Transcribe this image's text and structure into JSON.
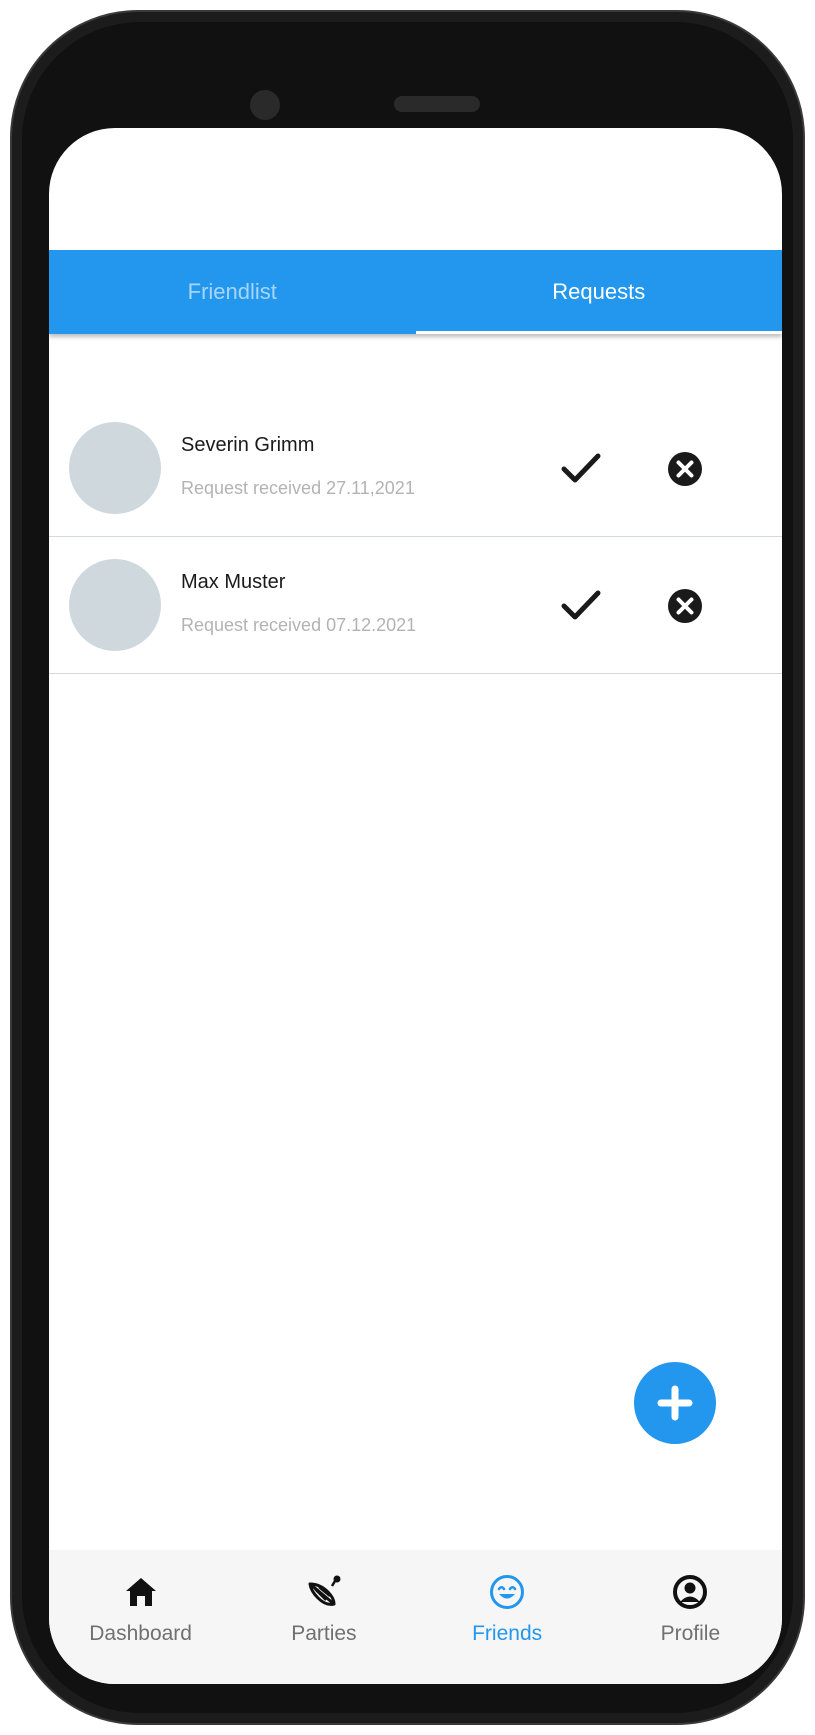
{
  "tabs": [
    {
      "label": "Friendlist",
      "active": false
    },
    {
      "label": "Requests",
      "active": true
    }
  ],
  "requests": [
    {
      "name": "Severin Grimm",
      "date": "Request received 27.11,2021"
    },
    {
      "name": "Max Muster",
      "date": "Request received 07.12.2021"
    }
  ],
  "icons": {
    "accept": "check-icon",
    "decline": "close-circle-icon",
    "add": "plus-icon"
  },
  "bottom_nav": [
    {
      "label": "Dashboard",
      "icon": "home-icon",
      "active": false
    },
    {
      "label": "Parties",
      "icon": "party-hat-icon",
      "active": false
    },
    {
      "label": "Friends",
      "icon": "smile-icon",
      "active": true
    },
    {
      "label": "Profile",
      "icon": "user-circle-icon",
      "active": false
    }
  ],
  "colors": {
    "primary": "#2396ee",
    "avatar": "#cfd8dd",
    "nav_background": "#f6f6f6",
    "device": "#1c1c1c"
  }
}
